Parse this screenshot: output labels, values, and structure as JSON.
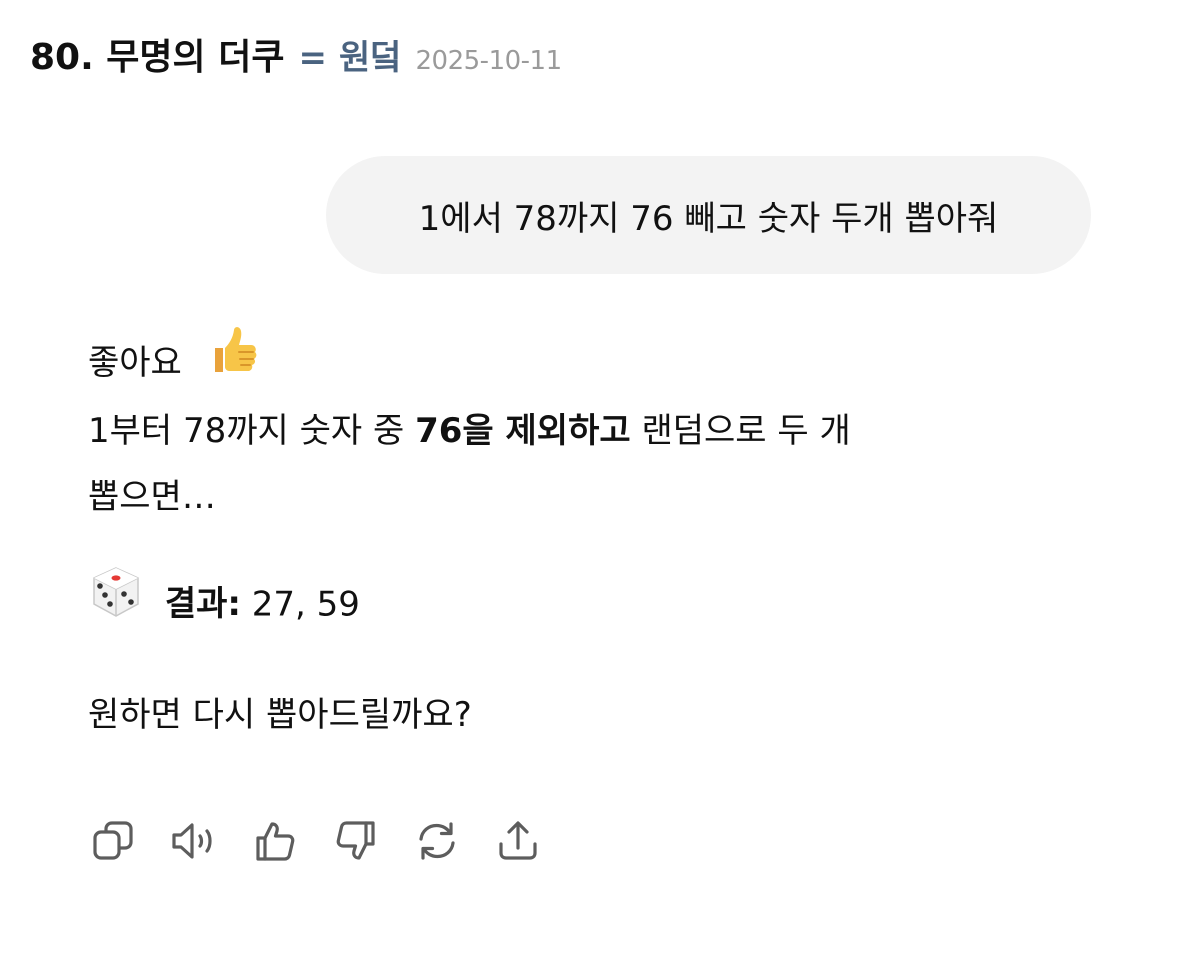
{
  "header": {
    "title": "80. 무명의 더쿠",
    "separator": "=",
    "alias": "원덬",
    "date": "2025-10-11"
  },
  "user_message": {
    "text": "1에서 78까지 76 빼고 숫자 두개 뽑아줘"
  },
  "assistant_message": {
    "line1": "좋아요",
    "line1_emoji": "thumbs-up-emoji",
    "line2_pre": "1부터 78까지 숫자 중 ",
    "line2_bold": "76을 제외하고",
    "line2_post": " 랜덤으로 두 개",
    "line3": "뽑으면…",
    "result_emoji": "dice-emoji",
    "result_label": "결과:",
    "result_value": " 27, 59",
    "closing": "원하면 다시 뽑아드릴까요?"
  },
  "actions": [
    {
      "name": "copy",
      "icon": "copy-icon"
    },
    {
      "name": "read-aloud",
      "icon": "speaker-icon"
    },
    {
      "name": "good-response",
      "icon": "thumbs-up-icon"
    },
    {
      "name": "bad-response",
      "icon": "thumbs-down-icon"
    },
    {
      "name": "regenerate",
      "icon": "refresh-icon"
    },
    {
      "name": "share",
      "icon": "share-icon"
    }
  ],
  "colors": {
    "bubble_bg": "#f3f3f3",
    "alias": "#4a6380",
    "date": "#9a9a9a",
    "icon_stroke": "#5d5d5d"
  }
}
